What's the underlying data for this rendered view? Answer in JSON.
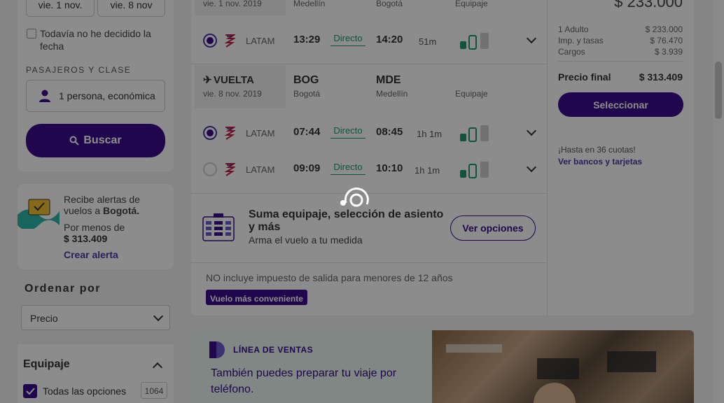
{
  "search": {
    "date_out": "vie. 1 nov.",
    "date_back": "vie. 8 nov",
    "undecided_label": "Todavía no he decidido la fecha",
    "passengers_heading": "PASAJEROS Y CLASE",
    "passengers_value": "1 persona, económica",
    "search_button": "Buscar"
  },
  "alert": {
    "line1": "Recibe alertas de vuelos a",
    "city": "Bogotá.",
    "for_less": "Por menos de",
    "price": "$ 313.409",
    "link": "Crear alerta"
  },
  "sort": {
    "heading": "Ordenar por",
    "selected": "Precio"
  },
  "filters": {
    "baggage_heading": "Equipaje",
    "all_options": "Todas las opciones",
    "all_count": "1064"
  },
  "outbound": {
    "header_date": "vie. 1 nov. 2019",
    "header_from": "Medellín",
    "header_to": "Bogotá",
    "header_bag": "Equipaje",
    "flights": [
      {
        "airline": "LATAM",
        "dep": "13:29",
        "type": "Directo",
        "arr": "14:20",
        "dur": "51m"
      }
    ]
  },
  "return": {
    "label": "VUELTA",
    "date": "vie. 8 nov. 2019",
    "from_code": "BOG",
    "from_city": "Bogotá",
    "to_code": "MDE",
    "to_city": "Medellín",
    "bag": "Equipaje",
    "flights": [
      {
        "airline": "LATAM",
        "dep": "07:44",
        "type": "Directo",
        "arr": "08:45",
        "dur": "1h 1m"
      },
      {
        "airline": "LATAM",
        "dep": "09:09",
        "type": "Directo",
        "arr": "10:10",
        "dur": "1h 1m"
      }
    ]
  },
  "upsell": {
    "title": "Suma equipaje, selección de asiento y más",
    "subtitle": "Arma el vuelo a tu medida",
    "button": "Ver opciones"
  },
  "notice": "NO incluye impuesto de salida para menores de 12 años",
  "badge": "Vuelo más conveniente",
  "price": {
    "top": "$ 233.000",
    "adult_label": "1 Adulto",
    "adult_value": "$ 233.000",
    "taxes_label": "Imp. y tasas",
    "taxes_value": "$ 76.470",
    "charges_label": "Cargos",
    "charges_value": "$ 3.939",
    "final_label": "Precio final",
    "final_value": "$ 313.409",
    "select_button": "Seleccionar",
    "installments": "¡Hasta en 36 cuotas!",
    "banks_link": "Ver bancos y tarjetas"
  },
  "sales": {
    "heading": "LÍNEA DE VENTAS",
    "text": "También puedes preparar tu viaje por teléfono."
  },
  "colors": {
    "brand": "#3b0b8a",
    "green": "#1c9a6c",
    "link": "#4a3aa6"
  }
}
